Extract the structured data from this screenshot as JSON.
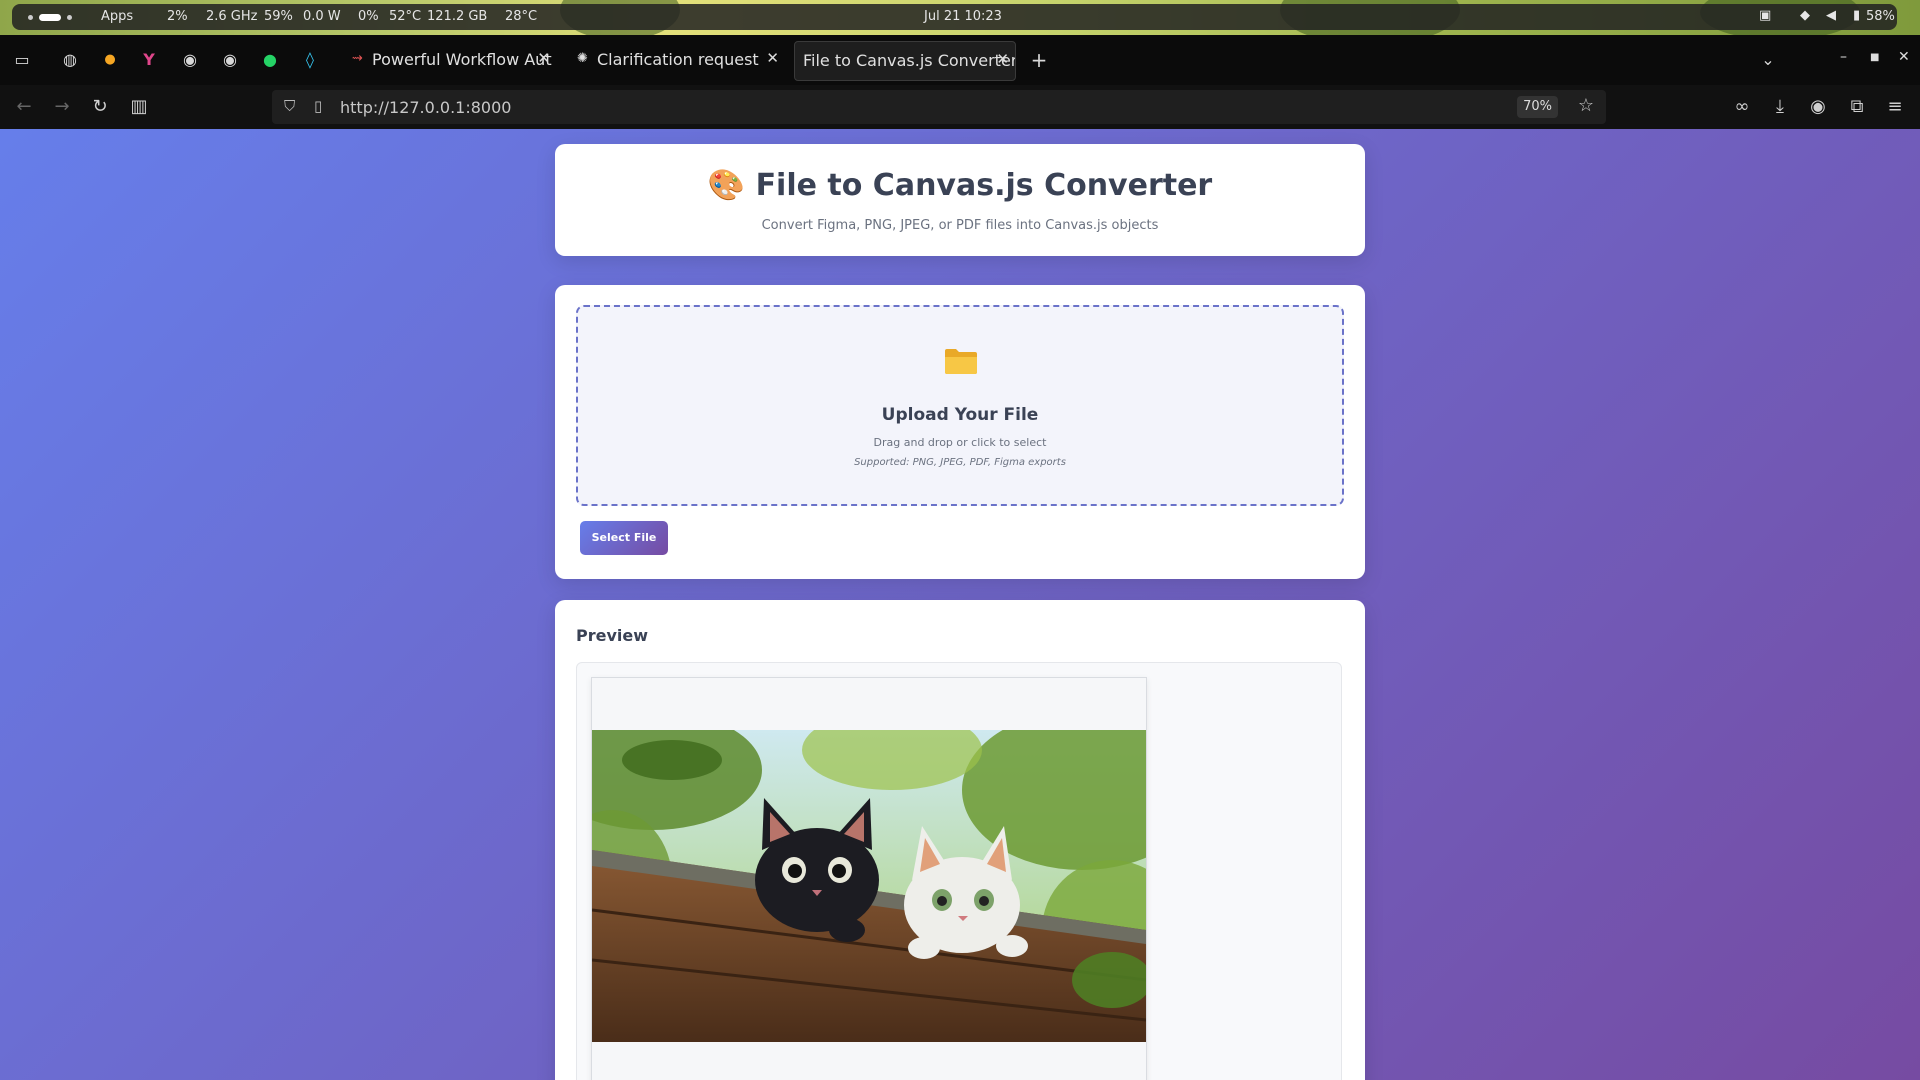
{
  "system_bar": {
    "apps_label": "Apps",
    "cpu": "2%",
    "freq": "2.6 GHz",
    "mem": "59%",
    "power": "0.0 W",
    "gpu": "0%",
    "temp1": "52°C",
    "disk": "121.2 GB",
    "temp2": "28°C",
    "clock": "Jul 21  10:23",
    "battery": "58%"
  },
  "tabs": [
    {
      "label": "Powerful Workflow Aut",
      "active": false
    },
    {
      "label": "Clarification request",
      "active": false
    },
    {
      "label": "File to Canvas.js Converter",
      "active": true
    }
  ],
  "browser": {
    "url": "http://127.0.0.1:8000",
    "zoom": "70%"
  },
  "header": {
    "title": "🎨 File to Canvas.js Converter",
    "subtitle": "Convert Figma, PNG, JPEG, or PDF files into Canvas.js objects"
  },
  "upload": {
    "title": "Upload Your File",
    "description": "Drag and drop or click to select",
    "supported": "Supported: PNG, JPEG, PDF, Figma exports",
    "button_label": "Select File"
  },
  "preview": {
    "title": "Preview"
  },
  "colors": {
    "gradient_start": "#667eea",
    "gradient_end": "#764ba2",
    "title_text": "#3a4255"
  }
}
